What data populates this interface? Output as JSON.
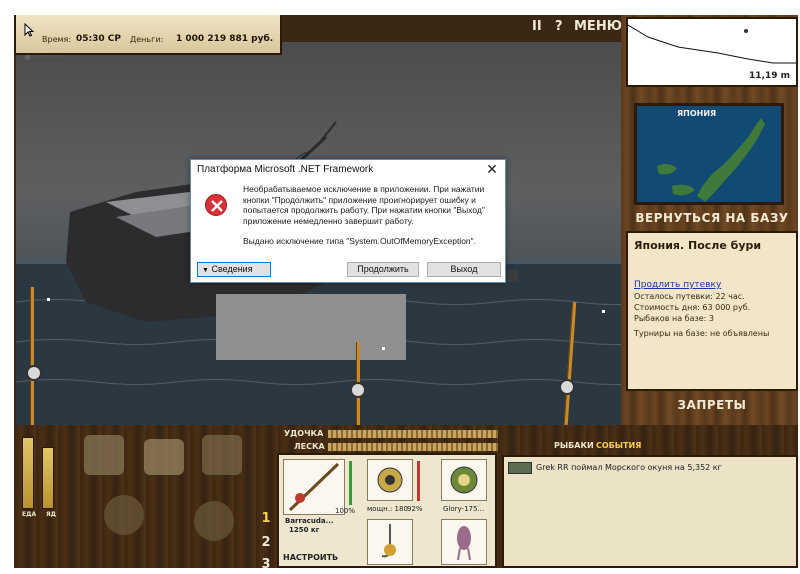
{
  "status_bar": {
    "time_label": "Время:",
    "time_value": "05:30 СР",
    "money_label": "Деньги:",
    "money_value": "1 000 219 881 руб."
  },
  "top_controls": {
    "pause_label": "II",
    "help_label": "?",
    "menu_label": "МЕНЮ"
  },
  "minimap": {
    "depth": "11,19 m"
  },
  "map": {
    "region_label": "ЯПОНИЯ"
  },
  "right_panel": {
    "return_button": "ВЕРНУТЬСЯ НА БАЗУ",
    "location_title": "Япония. После бури",
    "extend_trip_link": "Продлить путевку",
    "trip_remaining": "Осталось путевки: 22 час.",
    "base_cost": "Стоимость дня: 63 000 руб.",
    "anglers_on_base": "Рыбаков на базе: 3",
    "tournaments": "Турниры на базе: не объявлены",
    "bans_button": "ЗАПРЕТЫ"
  },
  "bottom": {
    "rod_label": "УДОЧКА",
    "line_label": "ЛЕСКА",
    "food_label": "ЕДА",
    "poison_label": "ЯД",
    "tab_fishermen": "РЫБАКИ",
    "tab_events": "СОБЫТИЯ",
    "rod_slot_number_1": "1",
    "rod_slot_number_2": "2",
    "rod_slot_number_3": "3",
    "rod_name": "Barracuda...",
    "rod_capacity": "1250 кг",
    "rod_percent": "100%",
    "reel_power": "мощн.: 180",
    "reel_percent": "92%",
    "line_name": "Glory-175...",
    "setup_label": "НАСТРОИТЬ"
  },
  "feed": {
    "message": "Grek RR поймал Морского окуня на 5,352 кг"
  },
  "dialog": {
    "title": "Платформа Microsoft .NET Framework",
    "message": "Необрабатываемое исключение в приложении. При нажатии кнопки \"Продолжить\" приложение проигнорирует ошибку и попытается продолжить работу. При нажатии кнопки \"Выход\" приложение немедленно завершит работу.",
    "exception": "Выдано исключение типа \"System.OutOfMemoryException\".",
    "details_button": "Сведения",
    "continue_button": "Продолжить",
    "exit_button": "Выход",
    "close_glyph": "✕"
  },
  "colors": {
    "link": "#1b36a8",
    "error_red": "#d8313a",
    "wood": "#5a3a1c",
    "parchment": "#f1e6c8"
  }
}
